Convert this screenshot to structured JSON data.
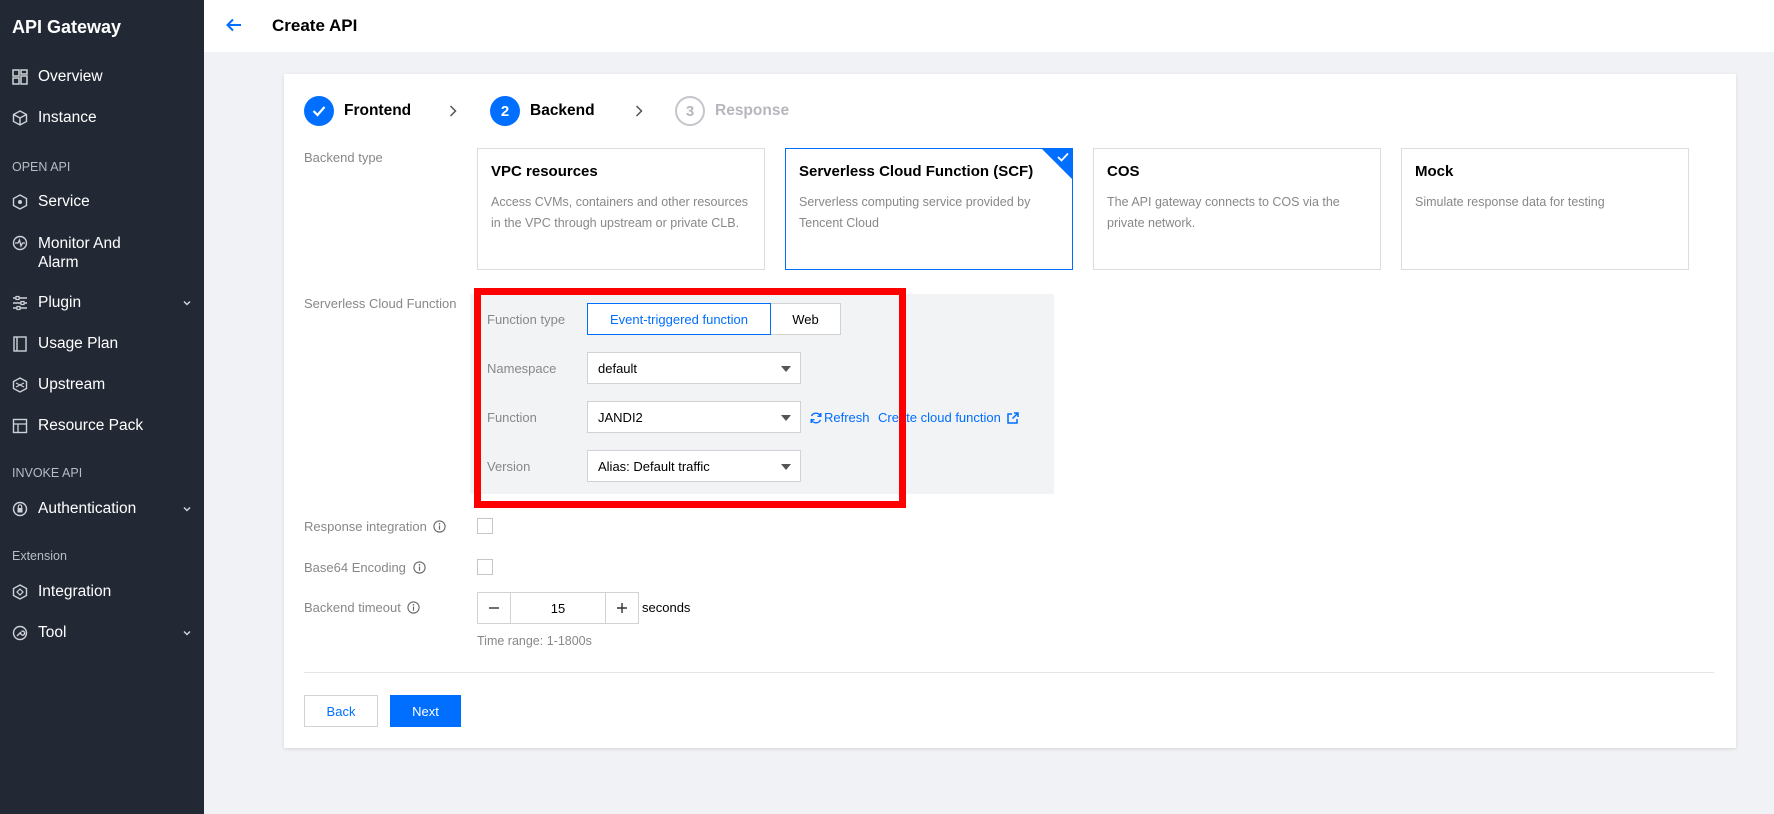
{
  "sidebar": {
    "brand": "API Gateway",
    "items": [
      {
        "label": "Overview",
        "icon": "dashboard-icon"
      },
      {
        "label": "Instance",
        "icon": "cube-icon"
      },
      {
        "label": "Service",
        "icon": "service-icon"
      },
      {
        "label": "Monitor And Alarm",
        "icon": "monitor-icon"
      },
      {
        "label": "Plugin",
        "icon": "plugin-icon",
        "expandable": true
      },
      {
        "label": "Usage Plan",
        "icon": "usage-plan-icon"
      },
      {
        "label": "Upstream",
        "icon": "upstream-icon"
      },
      {
        "label": "Resource Pack",
        "icon": "resource-pack-icon"
      },
      {
        "label": "Authentication",
        "icon": "authentication-icon",
        "expandable": true
      },
      {
        "label": "Integration",
        "icon": "integration-icon"
      },
      {
        "label": "Tool",
        "icon": "tool-icon",
        "expandable": true
      }
    ],
    "sections": {
      "open_api": "OPEN API",
      "invoke_api": "INVOKE API",
      "extension": "Extension"
    }
  },
  "header": {
    "title": "Create API"
  },
  "steps": [
    {
      "number": "1",
      "label": "Frontend",
      "state": "done"
    },
    {
      "number": "2",
      "label": "Backend",
      "state": "active"
    },
    {
      "number": "3",
      "label": "Response",
      "state": "pending"
    }
  ],
  "backend_type": {
    "label": "Backend type",
    "options": [
      {
        "title": "VPC resources",
        "desc": "Access CVMs, containers and other resources in the VPC through upstream or private CLB."
      },
      {
        "title": "Serverless Cloud Function (SCF)",
        "desc": "Serverless computing service provided by Tencent Cloud"
      },
      {
        "title": "COS",
        "desc": "The API gateway connects to COS via the private network."
      },
      {
        "title": "Mock",
        "desc": "Simulate response data for testing"
      }
    ],
    "selected": "Serverless Cloud Function (SCF)"
  },
  "scf": {
    "label": "Serverless Cloud Function",
    "function_type_label": "Function type",
    "function_type_options": [
      "Event-triggered function",
      "Web"
    ],
    "function_type_selected": "Event-triggered function",
    "namespace_label": "Namespace",
    "namespace_value": "default",
    "function_label": "Function",
    "function_value": "JANDI2",
    "refresh_label": "Refresh",
    "create_label": "Create cloud function",
    "version_label": "Version",
    "version_value": "Alias: Default traffic"
  },
  "options": {
    "response_integration_label": "Response integration",
    "base64_label": "Base64 Encoding",
    "timeout_label": "Backend timeout",
    "timeout_value": "15",
    "timeout_unit": "seconds",
    "timeout_hint": "Time range: 1-1800s"
  },
  "footer": {
    "back_label": "Back",
    "next_label": "Next"
  },
  "colors": {
    "sidebar_bg": "#222834",
    "accent": "#006eff",
    "highlight": "#ff0000"
  }
}
